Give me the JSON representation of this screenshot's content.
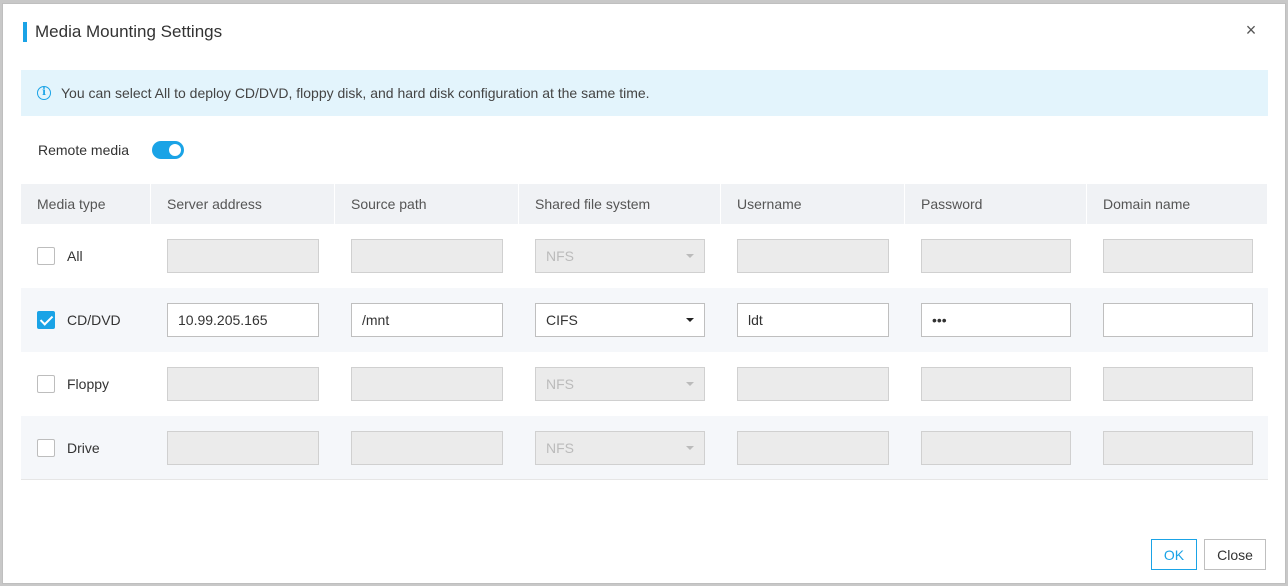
{
  "dialog": {
    "title": "Media Mounting Settings",
    "close_icon": "×"
  },
  "info": {
    "text": "You can select All to deploy CD/DVD, floppy disk, and hard disk configuration at the same time.",
    "icon": "info-icon"
  },
  "remote_media": {
    "label": "Remote media",
    "enabled": true
  },
  "table": {
    "headers": [
      "Media type",
      "Server address",
      "Source path",
      "Shared file system",
      "Username",
      "Password",
      "Domain name"
    ],
    "rows": [
      {
        "media": "All",
        "checked": false,
        "server": "",
        "path": "",
        "fs": "NFS",
        "user": "",
        "password": "",
        "domain": "",
        "enabled": false
      },
      {
        "media": "CD/DVD",
        "checked": true,
        "server": "10.99.205.165",
        "path": "/mnt",
        "fs": "CIFS",
        "user": "ldt",
        "password": "•••",
        "domain": "",
        "enabled": true
      },
      {
        "media": "Floppy",
        "checked": false,
        "server": "",
        "path": "",
        "fs": "NFS",
        "user": "",
        "password": "",
        "domain": "",
        "enabled": false
      },
      {
        "media": "Drive",
        "checked": false,
        "server": "",
        "path": "",
        "fs": "NFS",
        "user": "",
        "password": "",
        "domain": "",
        "enabled": false
      }
    ]
  },
  "buttons": {
    "ok": "OK",
    "close": "Close"
  },
  "colors": {
    "accent": "#1aa3e6",
    "info_bg": "#e3f4fc",
    "header_bg": "#f0f2f5"
  }
}
